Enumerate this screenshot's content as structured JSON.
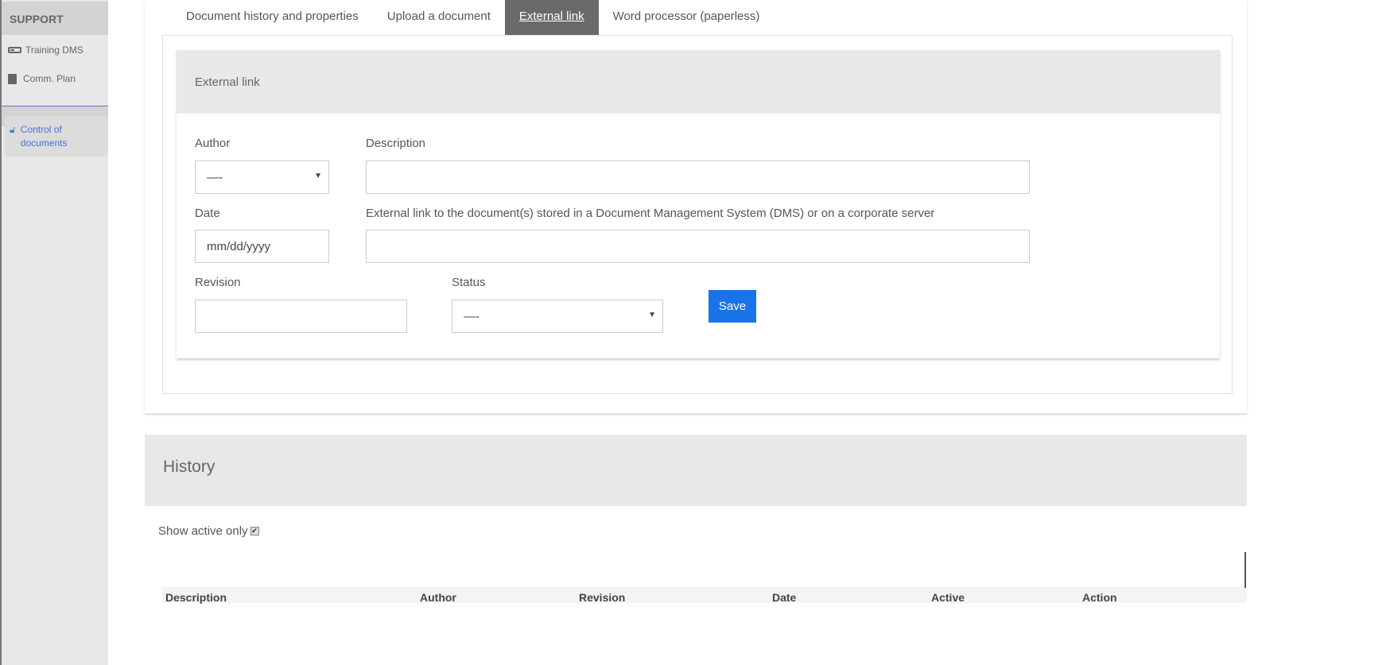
{
  "sidebar": {
    "section": "SUPPORT",
    "items": [
      {
        "label": "Training DMS",
        "icon": "battery-icon"
      },
      {
        "label": "Comm. Plan",
        "icon": "book-icon"
      }
    ],
    "active": {
      "label": "Control of documents",
      "icon": "unlock-icon"
    }
  },
  "tabs": [
    "Document history and properties",
    "Upload a document",
    "External link",
    "Word processor (paperless)"
  ],
  "active_tab": "External link",
  "form": {
    "title": "External link",
    "author_label": "Author",
    "author_value": "—-",
    "description_label": "Description",
    "date_label": "Date",
    "date_placeholder": "mm/dd/yyyy",
    "link_label": "External link to the document(s) stored in a Document Management System (DMS) or on a corporate server",
    "revision_label": "Revision",
    "status_label": "Status",
    "status_value": "—-",
    "save": "Save"
  },
  "history": {
    "title": "History",
    "show_active": "Show active only",
    "show_active_checked": true,
    "columns": [
      "Description",
      "Author",
      "Revision",
      "Date",
      "Active",
      "Action"
    ]
  },
  "colors": {
    "accent": "#1a73e8",
    "active_link": "#4d6fd8"
  }
}
